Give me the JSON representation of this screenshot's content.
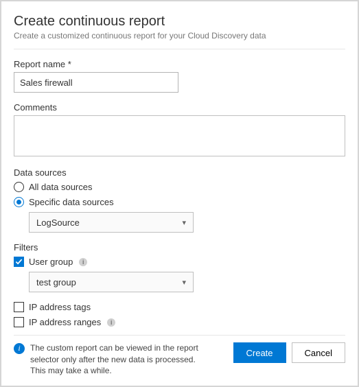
{
  "title": "Create continuous report",
  "subtitle": "Create a customized continuous report for your Cloud Discovery data",
  "fields": {
    "report_name": {
      "label": "Report name",
      "required_mark": "*",
      "value": "Sales firewall"
    },
    "comments": {
      "label": "Comments",
      "value": ""
    }
  },
  "data_sources": {
    "label": "Data sources",
    "options": {
      "all": "All data sources",
      "specific": "Specific data sources"
    },
    "selected": "specific",
    "source_select": {
      "value": "LogSource"
    }
  },
  "filters": {
    "label": "Filters",
    "user_group": {
      "label": "User group",
      "checked": true,
      "select_value": "test group"
    },
    "ip_tags": {
      "label": "IP address tags",
      "checked": false
    },
    "ip_ranges": {
      "label": "IP address ranges",
      "checked": false
    }
  },
  "footer": {
    "info_text": "The custom report can be viewed in the report selector only after the new data is processed.\nThis may take a while.",
    "create": "Create",
    "cancel": "Cancel"
  },
  "colors": {
    "accent": "#0078d4"
  }
}
